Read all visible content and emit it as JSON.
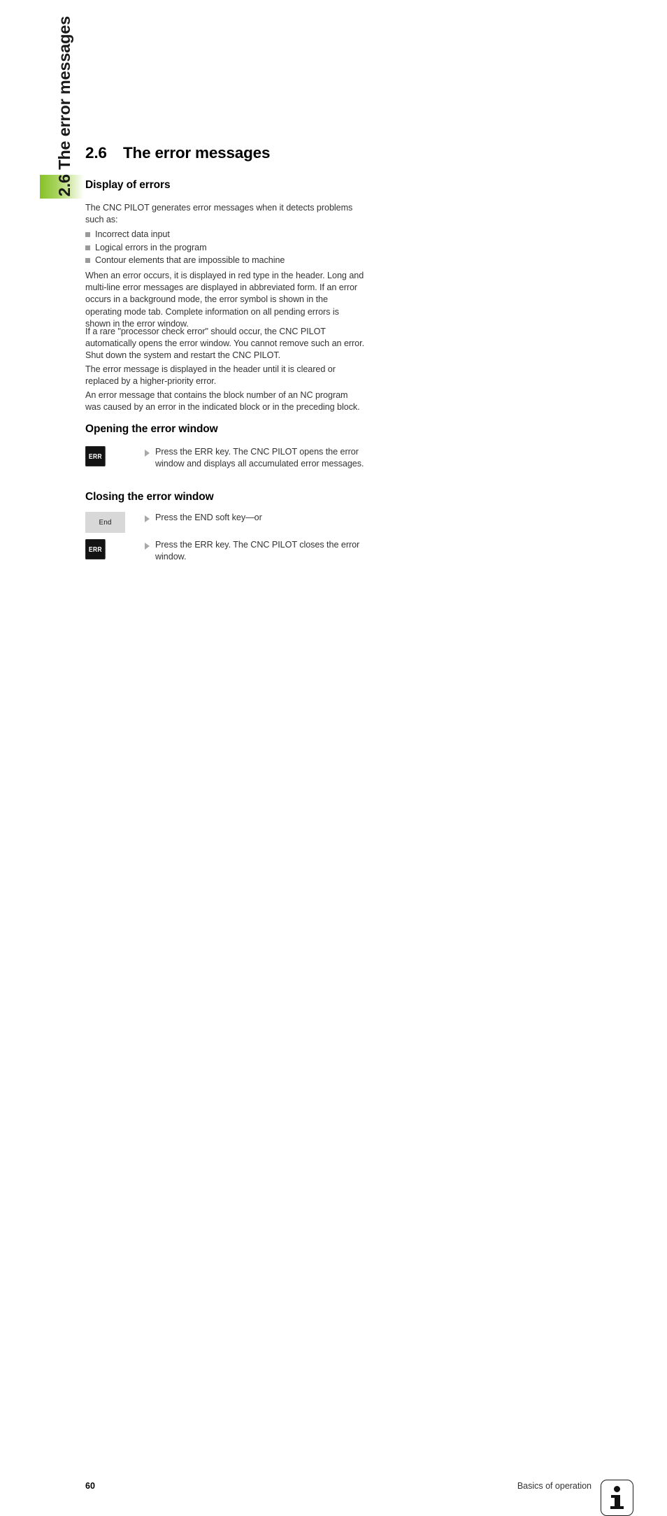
{
  "side_tab": {
    "running_head": "2.6 The error messages",
    "accent_color": "#86c226"
  },
  "chapter": {
    "number": "2.6",
    "title": "The error messages"
  },
  "sections": {
    "display_of_errors": {
      "heading": "Display of errors",
      "intro": "The CNC PILOT generates error messages when it detects problems such as:",
      "bullets": [
        "Incorrect data input",
        "Logical errors in the program",
        "Contour elements that are impossible to machine"
      ],
      "paragraphs": [
        "When an error occurs, it is displayed in red type in the header. Long and multi-line error messages are displayed in abbreviated form. If an error occurs in a background mode, the error symbol is shown in the operating mode tab. Complete information on all pending errors is shown in the error window.",
        "If a rare \"processor check error\" should occur, the CNC PILOT automatically opens the error window. You cannot remove such an error. Shut down the system and restart the CNC PILOT.",
        "The error message is displayed in the header until it is cleared or replaced by a higher-priority error.",
        "An error message that contains the block number of an NC program was caused by an error in the indicated block or in the preceding block."
      ]
    },
    "opening_the_error_window": {
      "heading": "Opening the error window",
      "steps": [
        {
          "key_label": "ERR",
          "key_type": "hardware-key",
          "text": "Press the ERR key. The CNC PILOT opens the error window and displays all accumulated error messages."
        }
      ]
    },
    "closing_the_error_window": {
      "heading": "Closing the error window",
      "steps": [
        {
          "key_label": "End",
          "key_type": "soft-key",
          "text": "Press the END soft key—or"
        },
        {
          "key_label": "ERR",
          "key_type": "hardware-key",
          "text": "Press the ERR key. The CNC PILOT closes the error window."
        }
      ]
    }
  },
  "footer": {
    "page_number": "60",
    "section_name": "Basics of operation",
    "badge_icon": "info-icon"
  }
}
